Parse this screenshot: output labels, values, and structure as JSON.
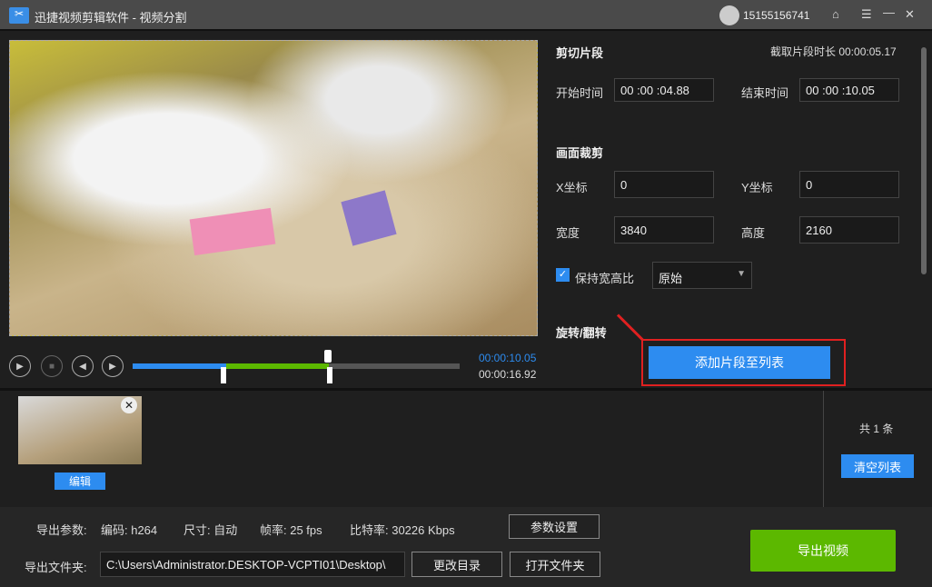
{
  "app": {
    "title": "迅捷视频剪辑软件 - 视频分割",
    "user": "15155156741"
  },
  "player": {
    "current_time": "00:00:10.05",
    "total_time": "00:00:16.92",
    "progress_start": 0.288,
    "progress_end": 0.594
  },
  "clip": {
    "heading": "剪切片段",
    "duration_label": "截取片段时长 00:00:05.17",
    "start_label": "开始时间",
    "start_value": "00 :00 :04.88",
    "end_label": "结束时间",
    "end_value": "00 :00 :10.05"
  },
  "crop": {
    "heading": "画面裁剪",
    "x_label": "X坐标",
    "x_value": "0",
    "y_label": "Y坐标",
    "y_value": "0",
    "w_label": "宽度",
    "w_value": "3840",
    "h_label": "高度",
    "h_value": "2160",
    "keep_ratio": "保持宽高比",
    "keep_ratio_checked": true,
    "ratio_value": "原始"
  },
  "rotate": {
    "heading": "旋转/翻转"
  },
  "add_button": "添加片段至列表",
  "list": {
    "edit": "编辑",
    "count": "共 1 条",
    "clear": "清空列表"
  },
  "export": {
    "params_label": "导出参数:",
    "codec": "编码: h264",
    "size": "尺寸: 自动",
    "fps": "帧率: 25 fps",
    "bitrate": "比特率: 30226 Kbps",
    "settings": "参数设置",
    "folder_label": "导出文件夹:",
    "folder": "C:\\Users\\Administrator.DESKTOP-VCPTI01\\Desktop\\",
    "change_dir": "更改目录",
    "open_folder": "打开文件夹",
    "export_button": "导出视频"
  },
  "colors": {
    "accent": "#2d8cf0",
    "green": "#5cb800",
    "highlight": "#e02020"
  }
}
